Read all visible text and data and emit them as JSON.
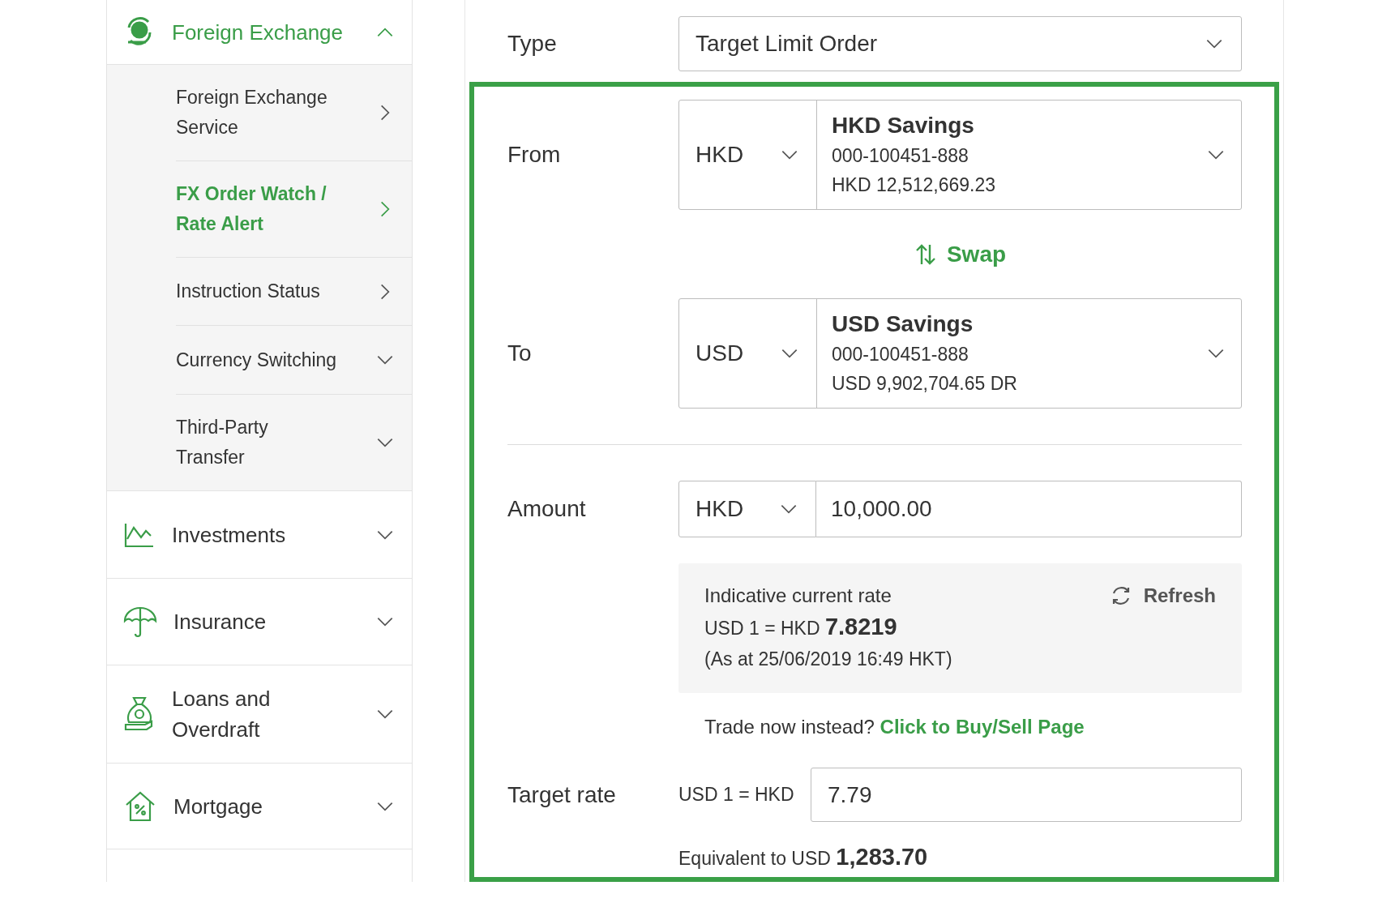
{
  "sidebar": [
    {
      "label": "Foreign Exchange",
      "kind": "group",
      "expanded": true,
      "selected": true,
      "children": [
        {
          "label": "Foreign Exchange Service",
          "kind": "link",
          "selected": false
        },
        {
          "label": "FX Order Watch / Rate Alert",
          "kind": "link",
          "selected": true
        },
        {
          "label": "Instruction Status",
          "kind": "link",
          "selected": false
        },
        {
          "label": "Currency Switching",
          "kind": "group",
          "expanded": false,
          "selected": false
        },
        {
          "label": "Third-Party Transfer",
          "kind": "group",
          "expanded": false,
          "selected": false
        }
      ]
    },
    {
      "label": "Investments",
      "kind": "group",
      "expanded": false,
      "selected": false
    },
    {
      "label": "Insurance",
      "kind": "group",
      "expanded": false,
      "selected": false
    },
    {
      "label": "Loans and Overdraft",
      "kind": "group",
      "expanded": false,
      "selected": false
    },
    {
      "label": "Mortgage",
      "kind": "group",
      "expanded": false,
      "selected": false
    }
  ],
  "form": {
    "type": {
      "label": "Type",
      "value": "Target Limit Order"
    },
    "from": {
      "label": "From",
      "currency": "HKD",
      "account_name": "HKD Savings",
      "account_number": "000-100451-888",
      "balance": "HKD 12,512,669.23"
    },
    "swap": {
      "label": "Swap"
    },
    "to": {
      "label": "To",
      "currency": "USD",
      "account_name": "USD Savings",
      "account_number": "000-100451-888",
      "balance": "USD 9,902,704.65 DR"
    },
    "amount": {
      "label": "Amount",
      "currency": "HKD",
      "value": "10,000.00"
    },
    "rate_box": {
      "title": "Indicative current rate",
      "rate": "USD 1 = HKD **7.8219**",
      "timestamp": "(As at 25/06/2019 16:49 HKT)",
      "refresh": "Refresh"
    },
    "trade_now": {
      "text": "Trade now instead?",
      "link": "Click to Buy/Sell Page"
    },
    "target_rate": {
      "label": "Target rate",
      "prefix": "USD 1 = HKD",
      "value": "7.79"
    },
    "equivalent": {
      "text": "Equivalent to USD **1,283.70**"
    }
  }
}
